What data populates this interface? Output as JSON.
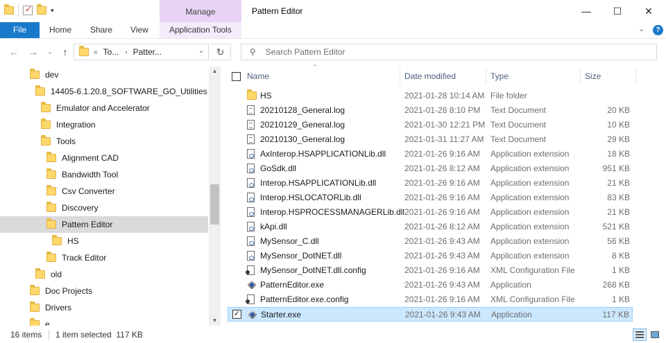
{
  "window": {
    "title": "Pattern Editor",
    "context_tab": "Manage",
    "controls": {
      "minimize": "—",
      "maximize": "☐",
      "close": "✕"
    }
  },
  "ribbon": {
    "file": "File",
    "tabs": [
      "Home",
      "Share",
      "View"
    ],
    "context_tab": "Application Tools",
    "expand_glyph": "⌄",
    "help_glyph": "?"
  },
  "address": {
    "back": "←",
    "forward": "→",
    "recent": "⌄",
    "up": "↑",
    "overflow": "«",
    "crumbs": [
      "To...",
      "Patter..."
    ],
    "refresh": "↻",
    "search_placeholder": "Search Pattern Editor"
  },
  "nav_tree": [
    {
      "label": "dev",
      "indent": 1,
      "selected": false
    },
    {
      "label": "14405-6.1.20.8_SOFTWARE_GO_Utilities",
      "indent": 2,
      "selected": false
    },
    {
      "label": "Emulator and Accelerator",
      "indent": 3,
      "selected": false
    },
    {
      "label": "Integration",
      "indent": 3,
      "selected": false
    },
    {
      "label": "Tools",
      "indent": 3,
      "selected": false
    },
    {
      "label": "Alignment CAD",
      "indent": 4,
      "selected": false
    },
    {
      "label": "Bandwidth Tool",
      "indent": 4,
      "selected": false
    },
    {
      "label": "Csv Converter",
      "indent": 4,
      "selected": false
    },
    {
      "label": "Discovery",
      "indent": 4,
      "selected": false
    },
    {
      "label": "Pattern Editor",
      "indent": 4,
      "selected": true
    },
    {
      "label": "HS",
      "indent": 5,
      "selected": false
    },
    {
      "label": "Track Editor",
      "indent": 4,
      "selected": false
    },
    {
      "label": "old",
      "indent": 2,
      "selected": false
    },
    {
      "label": "Doc Projects",
      "indent": 1,
      "selected": false
    },
    {
      "label": "Drivers",
      "indent": 1,
      "selected": false
    },
    {
      "label": "e",
      "indent": 1,
      "selected": false
    }
  ],
  "columns": {
    "name": "Name",
    "date": "Date modified",
    "type": "Type",
    "size": "Size"
  },
  "files": [
    {
      "name": "HS",
      "date": "2021-01-28 10:14 AM",
      "type": "File folder",
      "size": "",
      "icon": "folder-icon",
      "selected": false
    },
    {
      "name": "20210128_General.log",
      "date": "2021-01-28 8:10 PM",
      "type": "Text Document",
      "size": "20 KB",
      "icon": "text-document-icon",
      "selected": false
    },
    {
      "name": "20210129_General.log",
      "date": "2021-01-30 12:21 PM",
      "type": "Text Document",
      "size": "10 KB",
      "icon": "text-document-icon",
      "selected": false
    },
    {
      "name": "20210130_General.log",
      "date": "2021-01-31 11:27 AM",
      "type": "Text Document",
      "size": "29 KB",
      "icon": "text-document-icon",
      "selected": false
    },
    {
      "name": "AxInterop.HSAPPLICATIONLib.dll",
      "date": "2021-01-26 9:16 AM",
      "type": "Application extension",
      "size": "18 KB",
      "icon": "dll-icon",
      "selected": false
    },
    {
      "name": "GoSdk.dll",
      "date": "2021-01-26 8:12 AM",
      "type": "Application extension",
      "size": "951 KB",
      "icon": "dll-icon",
      "selected": false
    },
    {
      "name": "Interop.HSAPPLICATIONLib.dll",
      "date": "2021-01-26 9:16 AM",
      "type": "Application extension",
      "size": "21 KB",
      "icon": "dll-icon",
      "selected": false
    },
    {
      "name": "Interop.HSLOCATORLib.dll",
      "date": "2021-01-26 9:16 AM",
      "type": "Application extension",
      "size": "83 KB",
      "icon": "dll-icon",
      "selected": false
    },
    {
      "name": "Interop.HSPROCESSMANAGERLib.dll",
      "date": "2021-01-26 9:16 AM",
      "type": "Application extension",
      "size": "21 KB",
      "icon": "dll-icon",
      "selected": false
    },
    {
      "name": "kApi.dll",
      "date": "2021-01-26 8:12 AM",
      "type": "Application extension",
      "size": "521 KB",
      "icon": "dll-icon",
      "selected": false
    },
    {
      "name": "MySensor_C.dll",
      "date": "2021-01-26 9:43 AM",
      "type": "Application extension",
      "size": "56 KB",
      "icon": "dll-icon",
      "selected": false
    },
    {
      "name": "MySensor_DotNET.dll",
      "date": "2021-01-26 9:43 AM",
      "type": "Application extension",
      "size": "8 KB",
      "icon": "dll-icon",
      "selected": false
    },
    {
      "name": "MySensor_DotNET.dll.config",
      "date": "2021-01-26 9:16 AM",
      "type": "XML Configuration File",
      "size": "1 KB",
      "icon": "config-file-icon",
      "selected": false
    },
    {
      "name": "PatternEditor.exe",
      "date": "2021-01-26 9:43 AM",
      "type": "Application",
      "size": "268 KB",
      "icon": "executable-icon",
      "selected": false
    },
    {
      "name": "PatternEditor.exe.config",
      "date": "2021-01-26 9:16 AM",
      "type": "XML Configuration File",
      "size": "1 KB",
      "icon": "config-file-icon",
      "selected": false
    },
    {
      "name": "Starter.exe",
      "date": "2021-01-26 9:43 AM",
      "type": "Application",
      "size": "117 KB",
      "icon": "executable-icon",
      "selected": true
    }
  ],
  "status": {
    "items": "16 items",
    "selected": "1 item selected  117 KB"
  },
  "colors": {
    "file_tab": "#1979ca",
    "manage_tab": "#e8d3f5",
    "selected_row": "#cce8ff",
    "selected_tree": "#dadada",
    "folder": "#ffd86b"
  }
}
